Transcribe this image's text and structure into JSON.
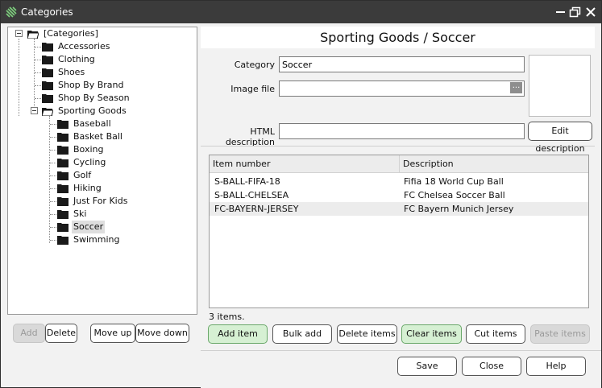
{
  "window": {
    "title": "Categories"
  },
  "tree": {
    "root": "[Categories]",
    "items": [
      {
        "label": "Accessories"
      },
      {
        "label": "Clothing"
      },
      {
        "label": "Shoes"
      },
      {
        "label": "Shop By Brand"
      },
      {
        "label": "Shop By Season"
      },
      {
        "label": "Sporting Goods"
      },
      {
        "label": "Baseball"
      },
      {
        "label": "Basket Ball"
      },
      {
        "label": "Boxing"
      },
      {
        "label": "Cycling"
      },
      {
        "label": "Golf"
      },
      {
        "label": "Hiking"
      },
      {
        "label": "Just For Kids"
      },
      {
        "label": "Ski"
      },
      {
        "label": "Soccer",
        "selected": true
      },
      {
        "label": "Swimming"
      }
    ],
    "buttons": {
      "add": "Add",
      "delete": "Delete",
      "move_up": "Move up",
      "move_down": "Move down"
    }
  },
  "detail": {
    "header": "Sporting Goods / Soccer",
    "category_label": "Category",
    "category_value": "Soccer",
    "image_label": "Image file",
    "image_value": "",
    "browse_label": "...",
    "html_label": "HTML description",
    "html_value": "",
    "edit_description": "Edit description"
  },
  "items_table": {
    "columns": [
      "Item number",
      "Description"
    ],
    "rows": [
      {
        "item_number": "S-BALL-FIFA-18",
        "description": "Fifia 18 World Cup Ball"
      },
      {
        "item_number": "S-BALL-CHELSEA",
        "description": "FC Chelsea Soccer Ball"
      },
      {
        "item_number": "FC-BAYERN-JERSEY",
        "description": "FC Bayern Munich Jersey"
      }
    ],
    "count_text": "3 items.",
    "buttons": {
      "add_item": "Add item",
      "bulk_add": "Bulk add",
      "delete_items": "Delete items",
      "clear_items": "Clear items",
      "cut_items": "Cut items",
      "paste_items": "Paste items"
    }
  },
  "footer": {
    "save": "Save",
    "close": "Close",
    "help": "Help"
  },
  "colors": {
    "titlebar": "#3b3b3b",
    "green_button": "#d6f0d3",
    "selection": "#dedede"
  }
}
